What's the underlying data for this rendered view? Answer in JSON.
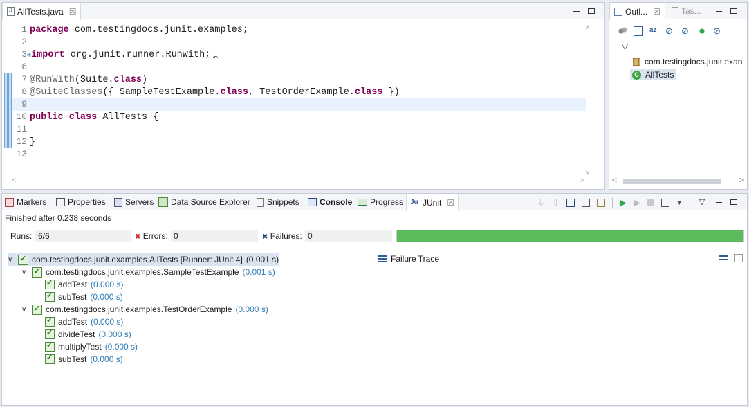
{
  "editor": {
    "tab_label": "AllTests.java",
    "lines": [
      {
        "n": "1"
      },
      {
        "n": "2"
      },
      {
        "n": "3"
      },
      {
        "n": "6"
      },
      {
        "n": "7"
      },
      {
        "n": "8"
      },
      {
        "n": "9"
      },
      {
        "n": "10"
      },
      {
        "n": "11"
      },
      {
        "n": "12"
      },
      {
        "n": "13"
      }
    ],
    "code": {
      "l1_kw": "package",
      "l1_rest": " com.testingdocs.junit.examples;",
      "l3_kw": "import",
      "l3_rest": " org.junit.runner.RunWith;",
      "l7_ann": "@RunWith",
      "l7_a": "(Suite.",
      "l7_kw": "class",
      "l7_b": ")",
      "l8_ann": "@SuiteClasses",
      "l8_a": "({ SampleTestExample.",
      "l8_kw1": "class",
      "l8_b": ", TestOrderExample.",
      "l8_kw2": "class",
      "l8_c": " })",
      "l10_kw1": "public",
      "l10_kw2": "class",
      "l10_rest": " AllTests {",
      "l12": "}"
    }
  },
  "outline": {
    "tab1": "Outl...",
    "tab2": "Tas...",
    "package": "com.testingdocs.junit.exan",
    "class": "AllTests"
  },
  "bottom": {
    "tabs": {
      "markers": "Markers",
      "properties": "Properties",
      "servers": "Servers",
      "datasource": "Data Source Explorer",
      "snippets": "Snippets",
      "console": "Console",
      "progress": "Progress",
      "junit": "JUnit"
    },
    "finished": "Finished after 0.238 seconds",
    "runs_label": "Runs:",
    "runs_value": "6/6",
    "errors_label": "Errors:",
    "errors_value": "0",
    "failures_label": "Failures:",
    "failures_value": "0",
    "progress_fraction": 1.0,
    "failure_trace": "Failure Trace",
    "tree": {
      "suite_name": "com.testingdocs.junit.examples.AllTests [Runner: JUnit 4]",
      "suite_time": "(0.001 s)",
      "c1_name": "com.testingdocs.junit.examples.SampleTestExample",
      "c1_time": "(0.001 s)",
      "c1_t1": "addTest",
      "c1_t1_time": "(0.000 s)",
      "c1_t2": "subTest",
      "c1_t2_time": "(0.000 s)",
      "c2_name": "com.testingdocs.junit.examples.TestOrderExample",
      "c2_time": "(0.000 s)",
      "c2_t1": "addTest",
      "c2_t1_time": "(0.000 s)",
      "c2_t2": "divideTest",
      "c2_t2_time": "(0.000 s)",
      "c2_t3": "multiplyTest",
      "c2_t3_time": "(0.000 s)",
      "c2_t4": "subTest",
      "c2_t4_time": "(0.000 s)"
    }
  },
  "colors": {
    "success": "#5cbb5c",
    "keyword": "#7f0055",
    "time": "#2c7db5"
  }
}
